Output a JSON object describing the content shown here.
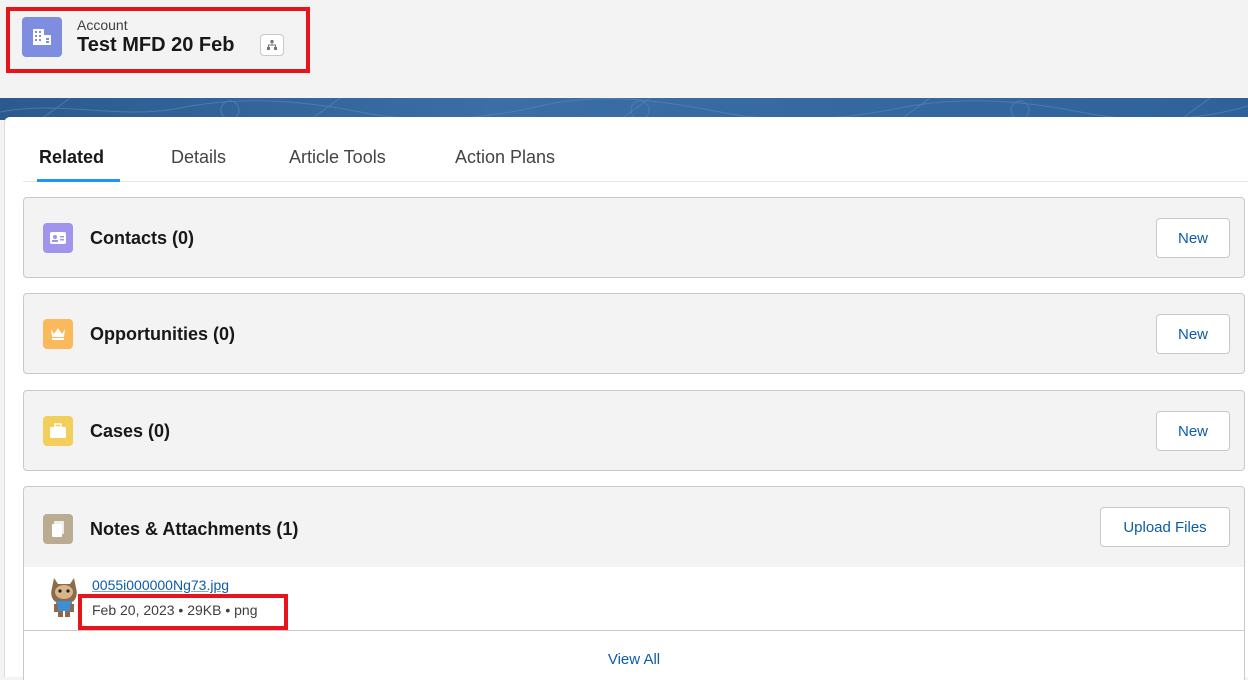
{
  "header": {
    "object_label": "Account",
    "record_title": "Test MFD 20 Feb",
    "object_icon": "account-building-icon",
    "hierarchy_icon": "hierarchy-icon"
  },
  "tabs": [
    {
      "label": "Related",
      "active": true
    },
    {
      "label": "Details",
      "active": false
    },
    {
      "label": "Article Tools",
      "active": false
    },
    {
      "label": "Action Plans",
      "active": false
    }
  ],
  "related_lists": [
    {
      "title": "Contacts (0)",
      "button": "New",
      "icon": "contact-card-icon",
      "color": "#a094ed"
    },
    {
      "title": "Opportunities (0)",
      "button": "New",
      "icon": "crown-icon",
      "color": "#fcb95b"
    },
    {
      "title": "Cases (0)",
      "button": "New",
      "icon": "briefcase-icon",
      "color": "#f2cf5b"
    },
    {
      "title": "Notes & Attachments (1)",
      "button": "Upload Files",
      "icon": "document-icon",
      "color": "#baac93"
    }
  ],
  "attachment": {
    "file_name": "0055i000000Ng73.jpg",
    "meta": "Feb 20, 2023 • 29KB • png"
  },
  "view_all": "View All",
  "colors": {
    "highlight": "#e8141c",
    "link": "#0b5cab",
    "tab_underline": "#1b96ff"
  }
}
